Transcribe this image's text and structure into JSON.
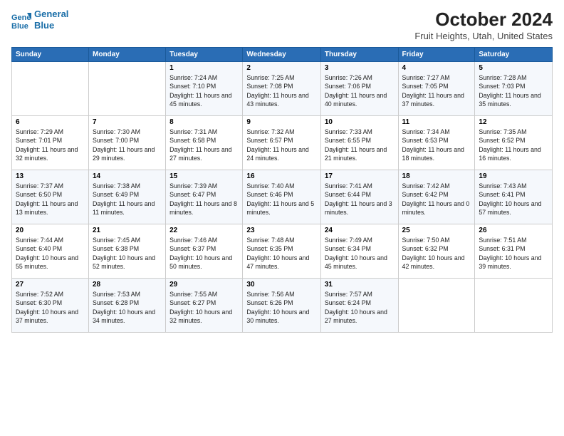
{
  "logo": {
    "line1": "General",
    "line2": "Blue"
  },
  "title": "October 2024",
  "subtitle": "Fruit Heights, Utah, United States",
  "weekdays": [
    "Sunday",
    "Monday",
    "Tuesday",
    "Wednesday",
    "Thursday",
    "Friday",
    "Saturday"
  ],
  "weeks": [
    [
      {
        "day": "",
        "sunrise": "",
        "sunset": "",
        "daylight": ""
      },
      {
        "day": "",
        "sunrise": "",
        "sunset": "",
        "daylight": ""
      },
      {
        "day": "1",
        "sunrise": "Sunrise: 7:24 AM",
        "sunset": "Sunset: 7:10 PM",
        "daylight": "Daylight: 11 hours and 45 minutes."
      },
      {
        "day": "2",
        "sunrise": "Sunrise: 7:25 AM",
        "sunset": "Sunset: 7:08 PM",
        "daylight": "Daylight: 11 hours and 43 minutes."
      },
      {
        "day": "3",
        "sunrise": "Sunrise: 7:26 AM",
        "sunset": "Sunset: 7:06 PM",
        "daylight": "Daylight: 11 hours and 40 minutes."
      },
      {
        "day": "4",
        "sunrise": "Sunrise: 7:27 AM",
        "sunset": "Sunset: 7:05 PM",
        "daylight": "Daylight: 11 hours and 37 minutes."
      },
      {
        "day": "5",
        "sunrise": "Sunrise: 7:28 AM",
        "sunset": "Sunset: 7:03 PM",
        "daylight": "Daylight: 11 hours and 35 minutes."
      }
    ],
    [
      {
        "day": "6",
        "sunrise": "Sunrise: 7:29 AM",
        "sunset": "Sunset: 7:01 PM",
        "daylight": "Daylight: 11 hours and 32 minutes."
      },
      {
        "day": "7",
        "sunrise": "Sunrise: 7:30 AM",
        "sunset": "Sunset: 7:00 PM",
        "daylight": "Daylight: 11 hours and 29 minutes."
      },
      {
        "day": "8",
        "sunrise": "Sunrise: 7:31 AM",
        "sunset": "Sunset: 6:58 PM",
        "daylight": "Daylight: 11 hours and 27 minutes."
      },
      {
        "day": "9",
        "sunrise": "Sunrise: 7:32 AM",
        "sunset": "Sunset: 6:57 PM",
        "daylight": "Daylight: 11 hours and 24 minutes."
      },
      {
        "day": "10",
        "sunrise": "Sunrise: 7:33 AM",
        "sunset": "Sunset: 6:55 PM",
        "daylight": "Daylight: 11 hours and 21 minutes."
      },
      {
        "day": "11",
        "sunrise": "Sunrise: 7:34 AM",
        "sunset": "Sunset: 6:53 PM",
        "daylight": "Daylight: 11 hours and 18 minutes."
      },
      {
        "day": "12",
        "sunrise": "Sunrise: 7:35 AM",
        "sunset": "Sunset: 6:52 PM",
        "daylight": "Daylight: 11 hours and 16 minutes."
      }
    ],
    [
      {
        "day": "13",
        "sunrise": "Sunrise: 7:37 AM",
        "sunset": "Sunset: 6:50 PM",
        "daylight": "Daylight: 11 hours and 13 minutes."
      },
      {
        "day": "14",
        "sunrise": "Sunrise: 7:38 AM",
        "sunset": "Sunset: 6:49 PM",
        "daylight": "Daylight: 11 hours and 11 minutes."
      },
      {
        "day": "15",
        "sunrise": "Sunrise: 7:39 AM",
        "sunset": "Sunset: 6:47 PM",
        "daylight": "Daylight: 11 hours and 8 minutes."
      },
      {
        "day": "16",
        "sunrise": "Sunrise: 7:40 AM",
        "sunset": "Sunset: 6:46 PM",
        "daylight": "Daylight: 11 hours and 5 minutes."
      },
      {
        "day": "17",
        "sunrise": "Sunrise: 7:41 AM",
        "sunset": "Sunset: 6:44 PM",
        "daylight": "Daylight: 11 hours and 3 minutes."
      },
      {
        "day": "18",
        "sunrise": "Sunrise: 7:42 AM",
        "sunset": "Sunset: 6:42 PM",
        "daylight": "Daylight: 11 hours and 0 minutes."
      },
      {
        "day": "19",
        "sunrise": "Sunrise: 7:43 AM",
        "sunset": "Sunset: 6:41 PM",
        "daylight": "Daylight: 10 hours and 57 minutes."
      }
    ],
    [
      {
        "day": "20",
        "sunrise": "Sunrise: 7:44 AM",
        "sunset": "Sunset: 6:40 PM",
        "daylight": "Daylight: 10 hours and 55 minutes."
      },
      {
        "day": "21",
        "sunrise": "Sunrise: 7:45 AM",
        "sunset": "Sunset: 6:38 PM",
        "daylight": "Daylight: 10 hours and 52 minutes."
      },
      {
        "day": "22",
        "sunrise": "Sunrise: 7:46 AM",
        "sunset": "Sunset: 6:37 PM",
        "daylight": "Daylight: 10 hours and 50 minutes."
      },
      {
        "day": "23",
        "sunrise": "Sunrise: 7:48 AM",
        "sunset": "Sunset: 6:35 PM",
        "daylight": "Daylight: 10 hours and 47 minutes."
      },
      {
        "day": "24",
        "sunrise": "Sunrise: 7:49 AM",
        "sunset": "Sunset: 6:34 PM",
        "daylight": "Daylight: 10 hours and 45 minutes."
      },
      {
        "day": "25",
        "sunrise": "Sunrise: 7:50 AM",
        "sunset": "Sunset: 6:32 PM",
        "daylight": "Daylight: 10 hours and 42 minutes."
      },
      {
        "day": "26",
        "sunrise": "Sunrise: 7:51 AM",
        "sunset": "Sunset: 6:31 PM",
        "daylight": "Daylight: 10 hours and 39 minutes."
      }
    ],
    [
      {
        "day": "27",
        "sunrise": "Sunrise: 7:52 AM",
        "sunset": "Sunset: 6:30 PM",
        "daylight": "Daylight: 10 hours and 37 minutes."
      },
      {
        "day": "28",
        "sunrise": "Sunrise: 7:53 AM",
        "sunset": "Sunset: 6:28 PM",
        "daylight": "Daylight: 10 hours and 34 minutes."
      },
      {
        "day": "29",
        "sunrise": "Sunrise: 7:55 AM",
        "sunset": "Sunset: 6:27 PM",
        "daylight": "Daylight: 10 hours and 32 minutes."
      },
      {
        "day": "30",
        "sunrise": "Sunrise: 7:56 AM",
        "sunset": "Sunset: 6:26 PM",
        "daylight": "Daylight: 10 hours and 30 minutes."
      },
      {
        "day": "31",
        "sunrise": "Sunrise: 7:57 AM",
        "sunset": "Sunset: 6:24 PM",
        "daylight": "Daylight: 10 hours and 27 minutes."
      },
      {
        "day": "",
        "sunrise": "",
        "sunset": "",
        "daylight": ""
      },
      {
        "day": "",
        "sunrise": "",
        "sunset": "",
        "daylight": ""
      }
    ]
  ]
}
